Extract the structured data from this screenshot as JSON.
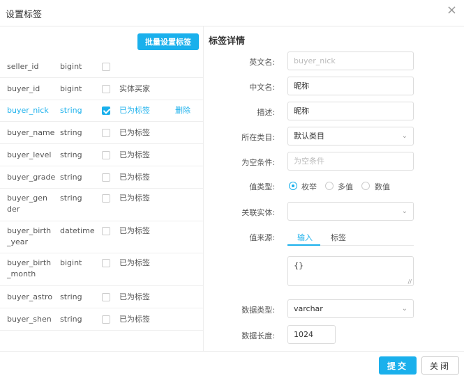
{
  "dialog": {
    "title": "设置标签",
    "close_icon": "×"
  },
  "toolbar": {
    "batch_label": "批量设置标签"
  },
  "rows": [
    {
      "name": "seller_id",
      "type": "bigint",
      "checked": false,
      "status": "",
      "action": ""
    },
    {
      "name": "buyer_id",
      "type": "bigint",
      "checked": false,
      "status": "实体买家",
      "action": ""
    },
    {
      "name": "buyer_nick",
      "type": "string",
      "checked": true,
      "status": "已为标签",
      "action": "删除"
    },
    {
      "name": "buyer_name",
      "type": "string",
      "checked": false,
      "status": "已为标签",
      "action": ""
    },
    {
      "name": "buyer_level",
      "type": "string",
      "checked": false,
      "status": "已为标签",
      "action": ""
    },
    {
      "name": "buyer_grade",
      "type": "string",
      "checked": false,
      "status": "已为标签",
      "action": ""
    },
    {
      "name": "buyer_gender",
      "type": "string",
      "checked": false,
      "status": "已为标签",
      "action": ""
    },
    {
      "name": "buyer_birth_year",
      "type": "datetime",
      "checked": false,
      "status": "已为标签",
      "action": ""
    },
    {
      "name": "buyer_birth_month",
      "type": "bigint",
      "checked": false,
      "status": "已为标签",
      "action": ""
    },
    {
      "name": "buyer_astro",
      "type": "string",
      "checked": false,
      "status": "已为标签",
      "action": ""
    },
    {
      "name": "buyer_shen",
      "type": "string",
      "checked": false,
      "status": "已为标签",
      "action": ""
    }
  ],
  "detail": {
    "title": "标签详情",
    "english_name": {
      "label": "英文名:",
      "placeholder": "buyer_nick"
    },
    "chinese_name": {
      "label": "中文名:",
      "value": "昵称"
    },
    "description": {
      "label": "描述:",
      "value": "昵称"
    },
    "category": {
      "label": "所在类目:",
      "value": "默认类目"
    },
    "empty_condition": {
      "label": "为空条件:",
      "placeholder": "为空条件"
    },
    "value_type": {
      "label": "值类型:",
      "options": [
        "枚举",
        "多值",
        "数值"
      ],
      "selected": "枚举"
    },
    "related_entity": {
      "label": "关联实体:",
      "value": ""
    },
    "value_source": {
      "label": "值来源:",
      "tabs": [
        "输入",
        "标签"
      ],
      "active": "输入",
      "content": "{}"
    },
    "data_type": {
      "label": "数据类型:",
      "value": "varchar"
    },
    "data_length": {
      "label": "数据长度:",
      "value": "1024"
    }
  },
  "footer": {
    "submit_label": "提交",
    "close_label": "关闭"
  },
  "colors": {
    "accent": "#1ab0ec",
    "border": "#dcdcdc"
  }
}
